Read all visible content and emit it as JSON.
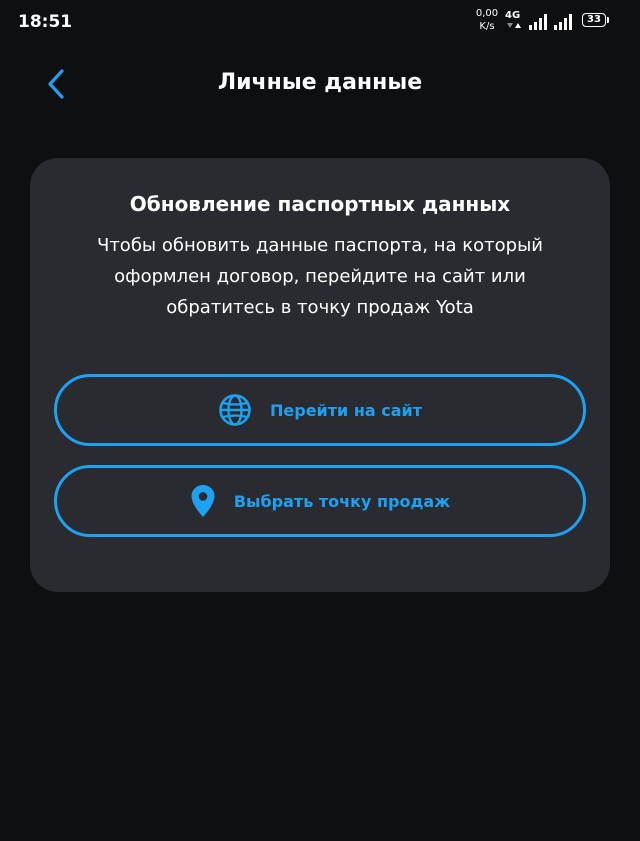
{
  "status_bar": {
    "time": "18:51",
    "net_speed_value": "0,00",
    "net_speed_unit": "K/s",
    "network_type": "4G",
    "battery_level": "33"
  },
  "header": {
    "title": "Личные данные",
    "back_icon": "chevron-left-icon"
  },
  "card": {
    "title": "Обновление паспортных данных",
    "text": "Чтобы обновить данные паспорта, на который оформлен договор, перейдите на сайт или обратитесь в точку продаж Yota"
  },
  "actions": {
    "site": {
      "label": "Перейти на сайт",
      "icon": "globe-icon"
    },
    "store": {
      "label": "Выбрать точку продаж",
      "icon": "map-pin-icon"
    }
  },
  "colors": {
    "background": "#0e0f11",
    "card": "#2a2b30",
    "accent": "#1da1f2",
    "text": "#ffffff"
  }
}
